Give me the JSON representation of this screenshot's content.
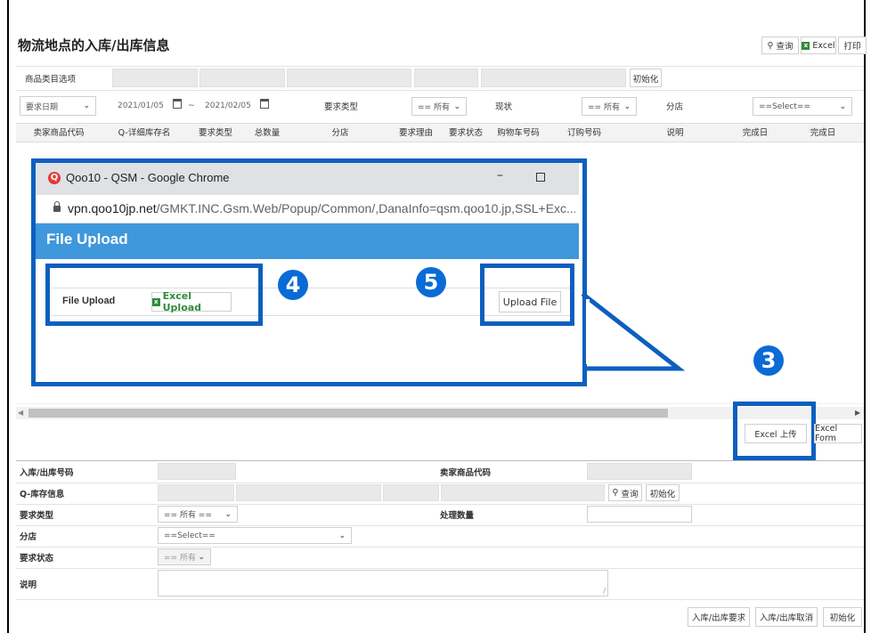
{
  "page": {
    "title": "物流地点的入库/出库信息",
    "toolbar": {
      "search": "查询",
      "excel": "Excel",
      "print": "打印"
    }
  },
  "filters": {
    "product_category_label": "商品类目选项",
    "init_button": "初始化",
    "date_type": "要求日期",
    "date_from": "2021/01/05",
    "date_to": "2021/02/05",
    "date_sep": "~",
    "request_type_label": "要求类型",
    "request_type_value": "== 所有",
    "status_label": "现状",
    "status_value": "== 所有",
    "branch_label": "分店",
    "branch_value": "==Select=="
  },
  "table": {
    "headers": [
      "卖家商品代码",
      "Q-详细库存名",
      "要求类型",
      "总数量",
      "分店",
      "要求理由",
      "要求状态",
      "购物车号码",
      "订购号码",
      "说明",
      "完成日",
      "完成日"
    ]
  },
  "popup": {
    "window_title": "Qoo10 - QSM - Google Chrome",
    "url_host": "vpn.qoo10jp.net",
    "url_path": "/GMKT.INC.Gsm.Web/Popup/Common/,DanaInfo=qsm.qoo10.jp,SSL+Exc...",
    "header": "File Upload",
    "row_label": "File Upload",
    "excel_upload": "Excel Upload",
    "upload_file": "Upload File"
  },
  "callouts": {
    "n3": "3",
    "n4": "4",
    "n5": "5"
  },
  "actions": {
    "excel_upload": "Excel 上传",
    "excel_form": "Excel Form"
  },
  "form": {
    "inout_no_label": "入库/出库号码",
    "seller_code_label": "卖家商品代码",
    "q_stock_label": "Q-库存信息",
    "search": "查询",
    "init": "初始化",
    "request_type_label": "要求类型",
    "request_type_value": "== 所有 ==",
    "process_qty_label": "处理数量",
    "branch_label": "分店",
    "branch_value": "==Select==",
    "request_status_label": "要求状态",
    "request_status_value": "== 所有",
    "note_label": "说明",
    "btn_request": "入库/出库要求",
    "btn_cancel": "入库/出库取消",
    "btn_init": "初始化"
  },
  "colors": {
    "callout_blue": "#0d5fbf",
    "popup_header": "#3f97dc",
    "excel_green": "#2e8b3a"
  }
}
